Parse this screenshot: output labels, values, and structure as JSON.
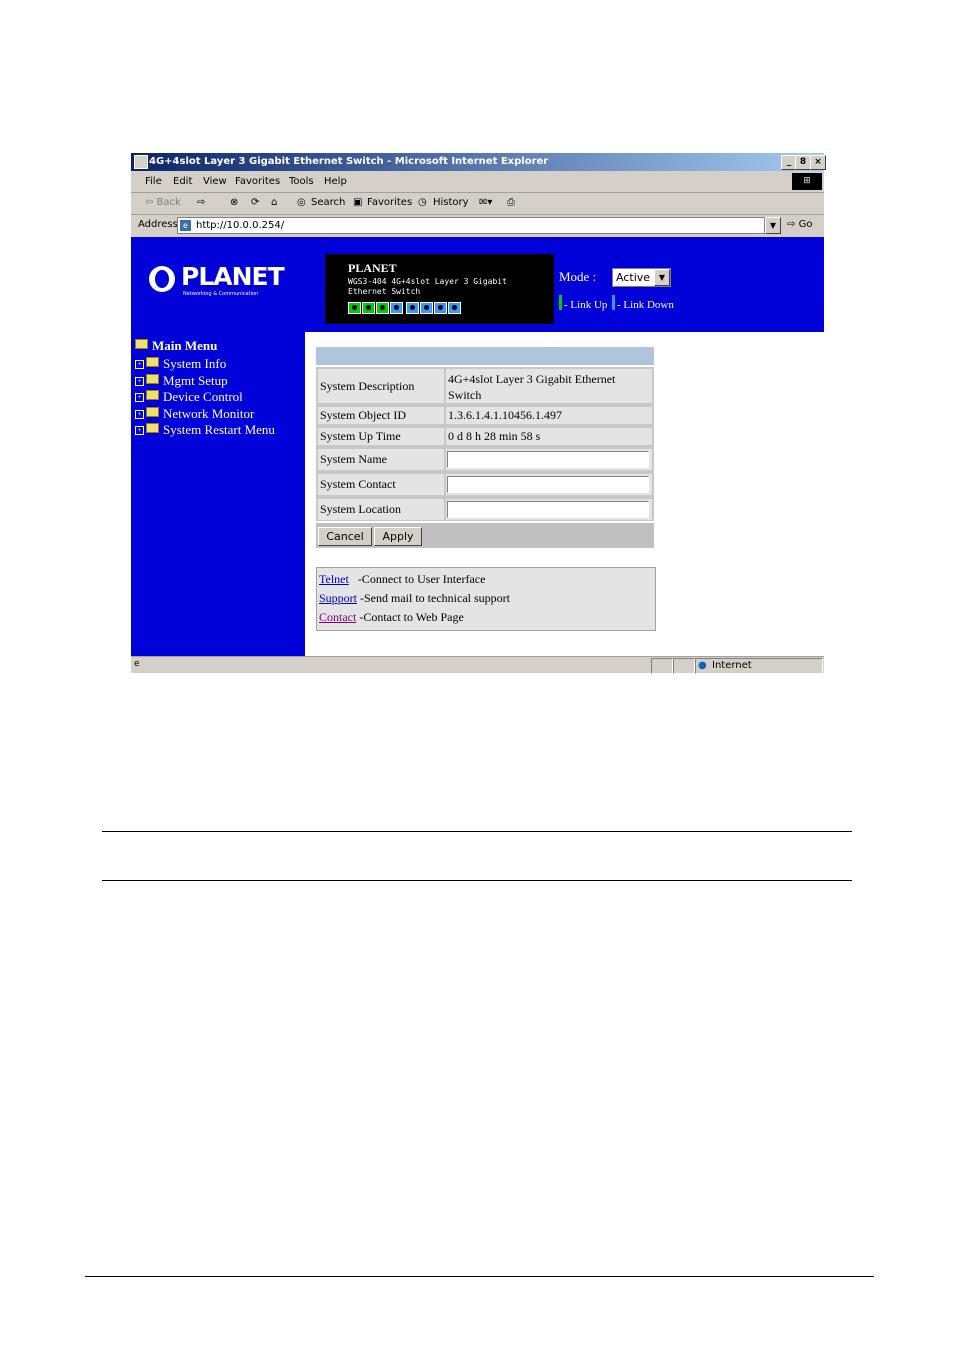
{
  "window": {
    "title": "4G+4slot Layer 3 Gigabit Ethernet Switch - Microsoft Internet Explorer",
    "controls": [
      "_",
      "8",
      "×"
    ]
  },
  "menubar": [
    "File",
    "Edit",
    "View",
    "Favorites",
    "Tools",
    "Help"
  ],
  "toolbar": {
    "back": "⇦ Back",
    "forward": "⇨",
    "search": "Search",
    "favorites": "Favorites",
    "history": "History"
  },
  "address": {
    "label": "Address",
    "url": "http://10.0.0.254/",
    "go": "Go"
  },
  "banner": {
    "logo": "PLANET",
    "logo_tagline": "Networking & Communication",
    "device_name": "PLANET",
    "device_model": "WGS3-404 4G+4slot Layer 3 Gigabit Ethernet Switch",
    "mode_label": "Mode :",
    "mode_value": "Active",
    "link_up": "- Link Up",
    "link_down": "- Link Down",
    "colors": {
      "banner": "#0000d8",
      "link_up": "#00cc00",
      "link_down": "#3399ff"
    }
  },
  "sidebar": {
    "title": "Main Menu",
    "items": [
      "System Info",
      "Mgmt Setup",
      "Device Control",
      "Network Monitor",
      "System Restart Menu"
    ]
  },
  "form": {
    "rows": [
      {
        "label": "System Description",
        "value": "4G+4slot Layer 3 Gigabit Ethernet Switch"
      },
      {
        "label": "System Object ID",
        "value": "1.3.6.1.4.1.10456.1.497"
      },
      {
        "label": "System Up Time",
        "value": "0 d 8 h 28 min 58 s"
      },
      {
        "label": "System Name",
        "value": ""
      },
      {
        "label": "System Contact",
        "value": ""
      },
      {
        "label": "System Location",
        "value": ""
      }
    ],
    "cancel": "Cancel",
    "apply": "Apply"
  },
  "links": [
    {
      "link": "Telnet",
      "text": "-Connect to User Interface"
    },
    {
      "link": "Support",
      "text": "-Send mail to technical support"
    },
    {
      "link": "Contact",
      "text": "-Contact to Web Page"
    }
  ],
  "status": {
    "zone": "Internet"
  }
}
